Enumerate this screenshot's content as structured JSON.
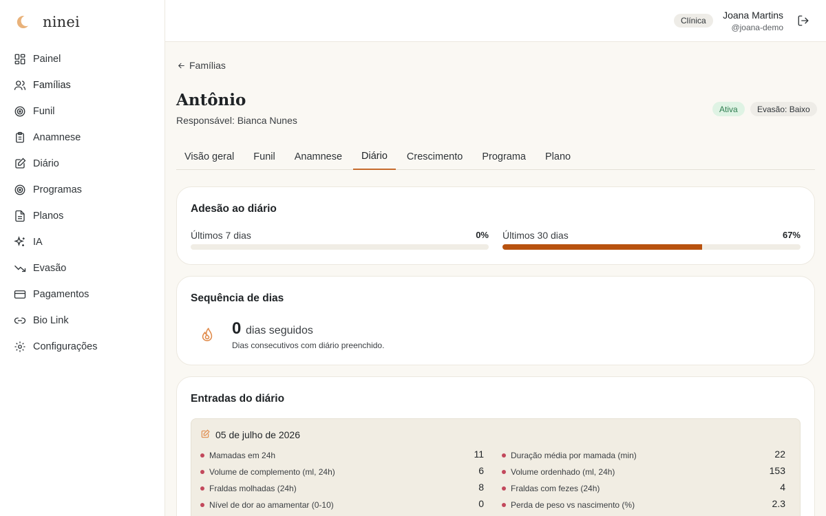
{
  "brand": {
    "name": "ninei"
  },
  "sidebar": {
    "items": [
      {
        "label": "Painel",
        "icon": "dashboard-icon"
      },
      {
        "label": "Famílias",
        "icon": "users-icon",
        "active": true
      },
      {
        "label": "Funil",
        "icon": "target-icon"
      },
      {
        "label": "Anamnese",
        "icon": "clipboard-icon"
      },
      {
        "label": "Diário",
        "icon": "journal-edit-icon"
      },
      {
        "label": "Programas",
        "icon": "target-icon"
      },
      {
        "label": "Planos",
        "icon": "file-icon"
      },
      {
        "label": "IA",
        "icon": "sparkles-icon"
      },
      {
        "label": "Evasão",
        "icon": "trending-down-icon"
      },
      {
        "label": "Pagamentos",
        "icon": "credit-card-icon"
      },
      {
        "label": "Bio Link",
        "icon": "link-icon"
      },
      {
        "label": "Configurações",
        "icon": "gear-icon"
      }
    ]
  },
  "topbar": {
    "role": "Clínica",
    "user_name": "Joana Martins",
    "user_handle": "@joana-demo",
    "logout_icon": "logout-icon"
  },
  "page": {
    "back_label": "Famílias",
    "patient_name": "Antônio",
    "responsible": "Responsável: Bianca Nunes",
    "status_badge": "Ativa",
    "evasion_badge": "Evasão: Baixo"
  },
  "tabs": [
    {
      "label": "Visão geral"
    },
    {
      "label": "Funil"
    },
    {
      "label": "Anamnese"
    },
    {
      "label": "Diário",
      "active": true
    },
    {
      "label": "Crescimento"
    },
    {
      "label": "Programa"
    },
    {
      "label": "Plano"
    }
  ],
  "adherence": {
    "title": "Adesão ao diário",
    "last7": {
      "label": "Últimos 7 dias",
      "value": "0%",
      "fraction": 0
    },
    "last30": {
      "label": "Últimos 30 dias",
      "value": "67%",
      "fraction": 0.67
    }
  },
  "streak": {
    "title": "Sequência de dias",
    "count": "0",
    "unit": "dias seguidos",
    "description": "Dias consecutivos com diário preenchido."
  },
  "entries": {
    "title": "Entradas do diário",
    "items": [
      {
        "date": "05 de julho de 2026",
        "left": [
          {
            "label": "Mamadas em 24h",
            "value": "11"
          },
          {
            "label": "Volume de complemento (ml, 24h)",
            "value": "6"
          },
          {
            "label": "Fraldas molhadas (24h)",
            "value": "8"
          },
          {
            "label": "Nível de dor ao amamentar (0-10)",
            "value": "0"
          }
        ],
        "right": [
          {
            "label": "Duração média por mamada (min)",
            "value": "22"
          },
          {
            "label": "Volume ordenhado (ml, 24h)",
            "value": "153"
          },
          {
            "label": "Fraldas com fezes (24h)",
            "value": "4"
          },
          {
            "label": "Perda de peso vs nascimento (%)",
            "value": "2.3"
          }
        ]
      }
    ]
  },
  "colors": {
    "accent": "#c66a2b",
    "progress": "#b8520f",
    "dot": "#c2485c",
    "active_badge_bg": "#dff3e4",
    "active_badge_text": "#2e7d4f"
  }
}
